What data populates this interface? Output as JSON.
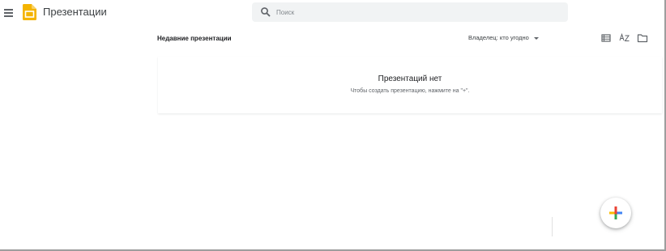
{
  "header": {
    "app_title": "Презентации",
    "app_logo_icon": "slides-logo-icon",
    "menu_icon": "hamburger-menu-icon",
    "brand_color": "#F4B400"
  },
  "search": {
    "placeholder": "Поиск",
    "value": "",
    "icon": "search-icon"
  },
  "main": {
    "section_title": "Недавние презентации",
    "owner_filter_label": "Владелец: кто угодно",
    "tools": [
      {
        "name": "list-view-icon"
      },
      {
        "name": "sort-az-icon"
      },
      {
        "name": "folder-icon"
      }
    ],
    "empty_state": {
      "title": "Презентаций нет",
      "hint": "Чтобы создать презентацию, нажмите на \"+\"."
    }
  },
  "fab": {
    "icon": "plus-icon",
    "colors": [
      "#EA4335",
      "#4285F4",
      "#34A853",
      "#FBBC04"
    ]
  }
}
